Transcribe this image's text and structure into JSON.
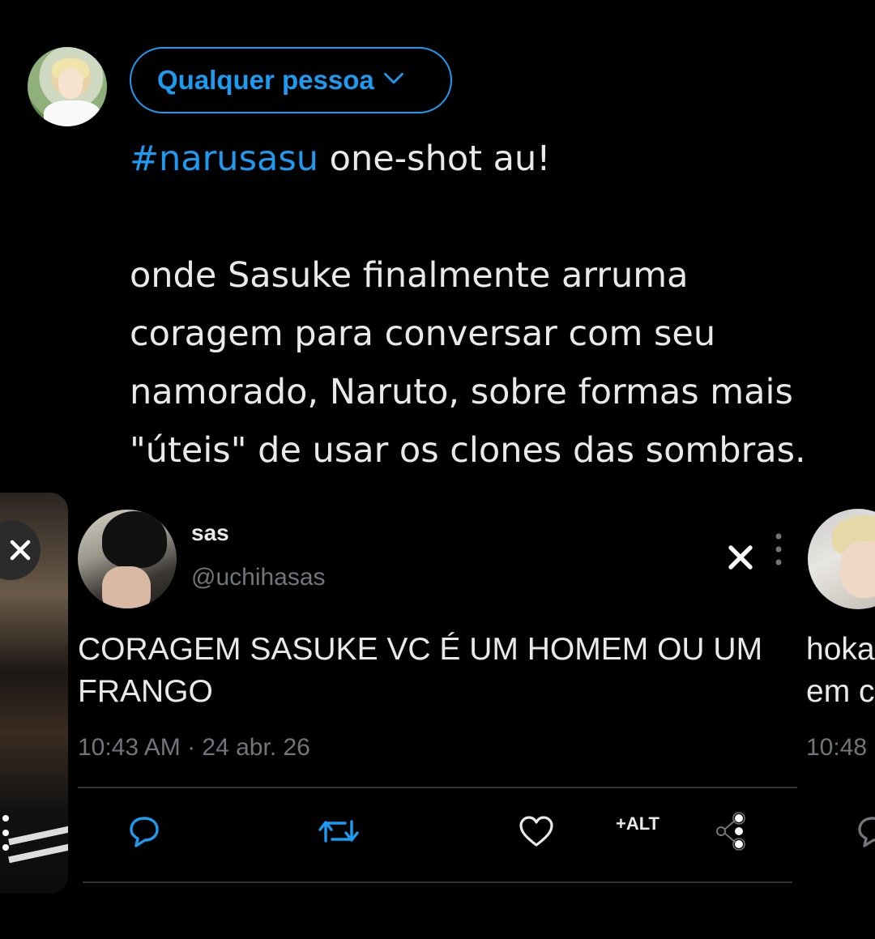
{
  "composer": {
    "audience_label": "Qualquer pessoa",
    "hashtag": "#narusasu",
    "title_rest": " one-shot au!",
    "body": "onde Sasuke finalmente arruma\ncoragem para conversar com seu\nnamorado, Naruto, sobre formas mais\n\"úteis\" de usar os clones das sombras."
  },
  "quoted_tweet": {
    "name": "sas",
    "handle": "@uchihasas",
    "text": "CORAGEM SASUKE VC É UM HOMEM OU UM FRANGO",
    "timestamp": "10:43 AM · 24 abr. 26",
    "alt_label": "+ALT"
  },
  "next_card": {
    "text_line1": "hoka",
    "text_line2": "em c",
    "timestamp": "10:48"
  },
  "colors": {
    "accent": "#1d9bf0",
    "background": "#000000",
    "text": "#e7e9ea",
    "muted": "#71767b",
    "divider": "#2f3336"
  }
}
